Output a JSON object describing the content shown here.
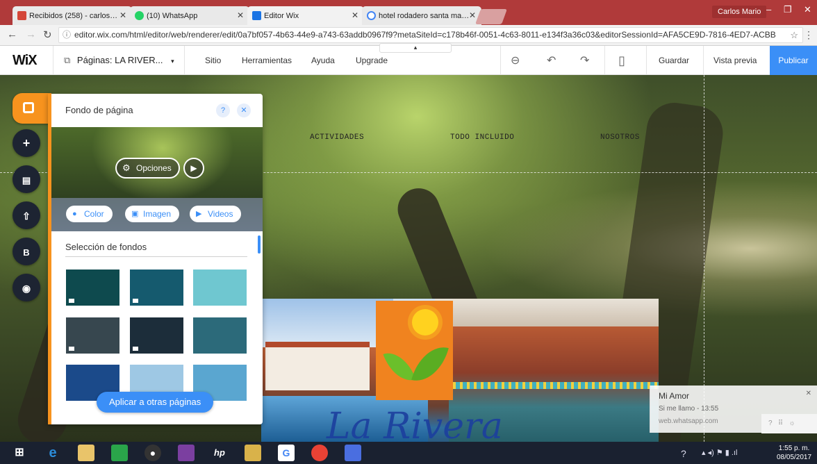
{
  "browser": {
    "tabs": [
      {
        "title": "Recibidos (258) - carlos…",
        "favicon_color": "#d44638"
      },
      {
        "title": "(10) WhatsApp",
        "favicon_color": "#25d366"
      },
      {
        "title": "Editor Wix",
        "favicon_color": "#1b74e4"
      },
      {
        "title": "hotel rodadero santa ma…",
        "favicon_color": "#4285f4"
      }
    ],
    "user": "Carlos Mario",
    "url": "editor.wix.com/html/editor/web/renderer/edit/0a7bf057-4b63-44e9-a743-63addb0967f9?metaSiteId=c178b46f-0051-4c63-8011-e134f3a36c03&editorSessionId=AFA5CE9D-7816-4ED7-ACBB",
    "minimize": "–",
    "maximize": "❐",
    "close": "✕"
  },
  "wix": {
    "logo": "WiX",
    "pages_label": "Páginas: LA RIVER...",
    "menu": [
      "Sitio",
      "Herramientas",
      "Ayuda",
      "Upgrade"
    ],
    "save": "Guardar",
    "preview": "Vista previa",
    "publish": "Publicar",
    "colors": {
      "publish": "#3b8ff7",
      "accent": "#f7931e"
    }
  },
  "site": {
    "nav": [
      "ACTIVIDADES",
      "TODO INCLUIDO",
      "NOSOTROS"
    ],
    "brand": "La Rivera"
  },
  "panel": {
    "title": "Fondo de página",
    "help": "?",
    "close": "✕",
    "options": "Opciones",
    "sources": [
      "Color",
      "Imagen",
      "Videos"
    ],
    "section_title": "Selección de fondos",
    "apply": "Aplicar a otras páginas",
    "thumbnails": [
      {
        "color": "#0e4a4e",
        "video": true
      },
      {
        "color": "#155a6e",
        "video": true
      },
      {
        "color": "#6fc7d0",
        "video": false
      },
      {
        "color": "#37474f",
        "video": true
      },
      {
        "color": "#1c2d3a",
        "video": true
      },
      {
        "color": "#2c6a7a",
        "video": false
      },
      {
        "color": "#1b4a8a",
        "video": false
      },
      {
        "color": "#9ec8e4",
        "video": false
      },
      {
        "color": "#5aa6d0",
        "video": false
      }
    ]
  },
  "notification": {
    "title": "Mi Amor",
    "message": "Si me llamo - 13:55",
    "source": "web.whatsapp.com",
    "close": "✕"
  },
  "taskbar": {
    "time": "1:55 p. m.",
    "date": "08/05/2017"
  }
}
